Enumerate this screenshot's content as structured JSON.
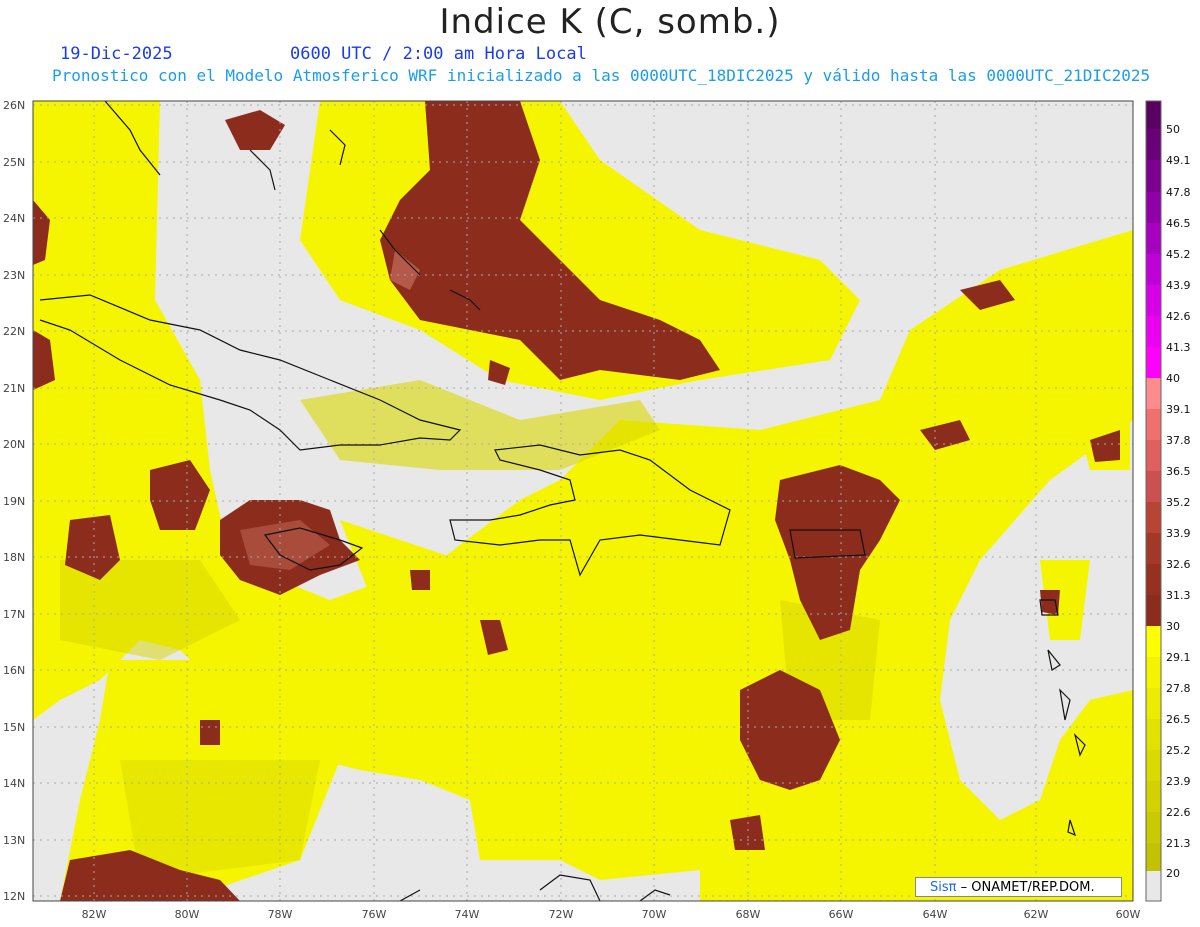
{
  "header": {
    "title": "Indice K (C, somb.)",
    "date": "19-Dic-2025",
    "time": "0600 UTC / 2:00 am Hora Local",
    "subtitle": "Pronostico con el Modelo Atmosferico WRF inicializado a las 0000UTC_18DIC2025 y válido hasta las  0000UTC_21DIC2025"
  },
  "map": {
    "lat_labels": [
      "26N",
      "25N",
      "24N",
      "23N",
      "22N",
      "21N",
      "20N",
      "19N",
      "18N",
      "17N",
      "16N",
      "15N",
      "14N",
      "13N",
      "12N"
    ],
    "lon_labels": [
      "82W",
      "80W",
      "78W",
      "76W",
      "74W",
      "72W",
      "70W",
      "68W",
      "66W",
      "64W",
      "62W",
      "60W"
    ]
  },
  "colorbar": {
    "labels": [
      "50",
      "49.1",
      "47.8",
      "46.5",
      "45.2",
      "43.9",
      "42.6",
      "41.3",
      "40",
      "39.1",
      "37.8",
      "36.5",
      "35.2",
      "33.9",
      "32.6",
      "31.3",
      "30",
      "29.1",
      "27.8",
      "26.5",
      "25.2",
      "23.9",
      "22.6",
      "21.3",
      "20"
    ],
    "colors": {
      "none": "#e8e8e8",
      "low": "#ffff00",
      "mid": "#d6d600",
      "high": "#8c2c1c",
      "very_high": "#c06060",
      "extreme": "#ff00ff",
      "max": "#6a006a"
    }
  },
  "credit": {
    "brand": "Sisπ",
    "text": " – ONAMET/REP.DOM."
  }
}
